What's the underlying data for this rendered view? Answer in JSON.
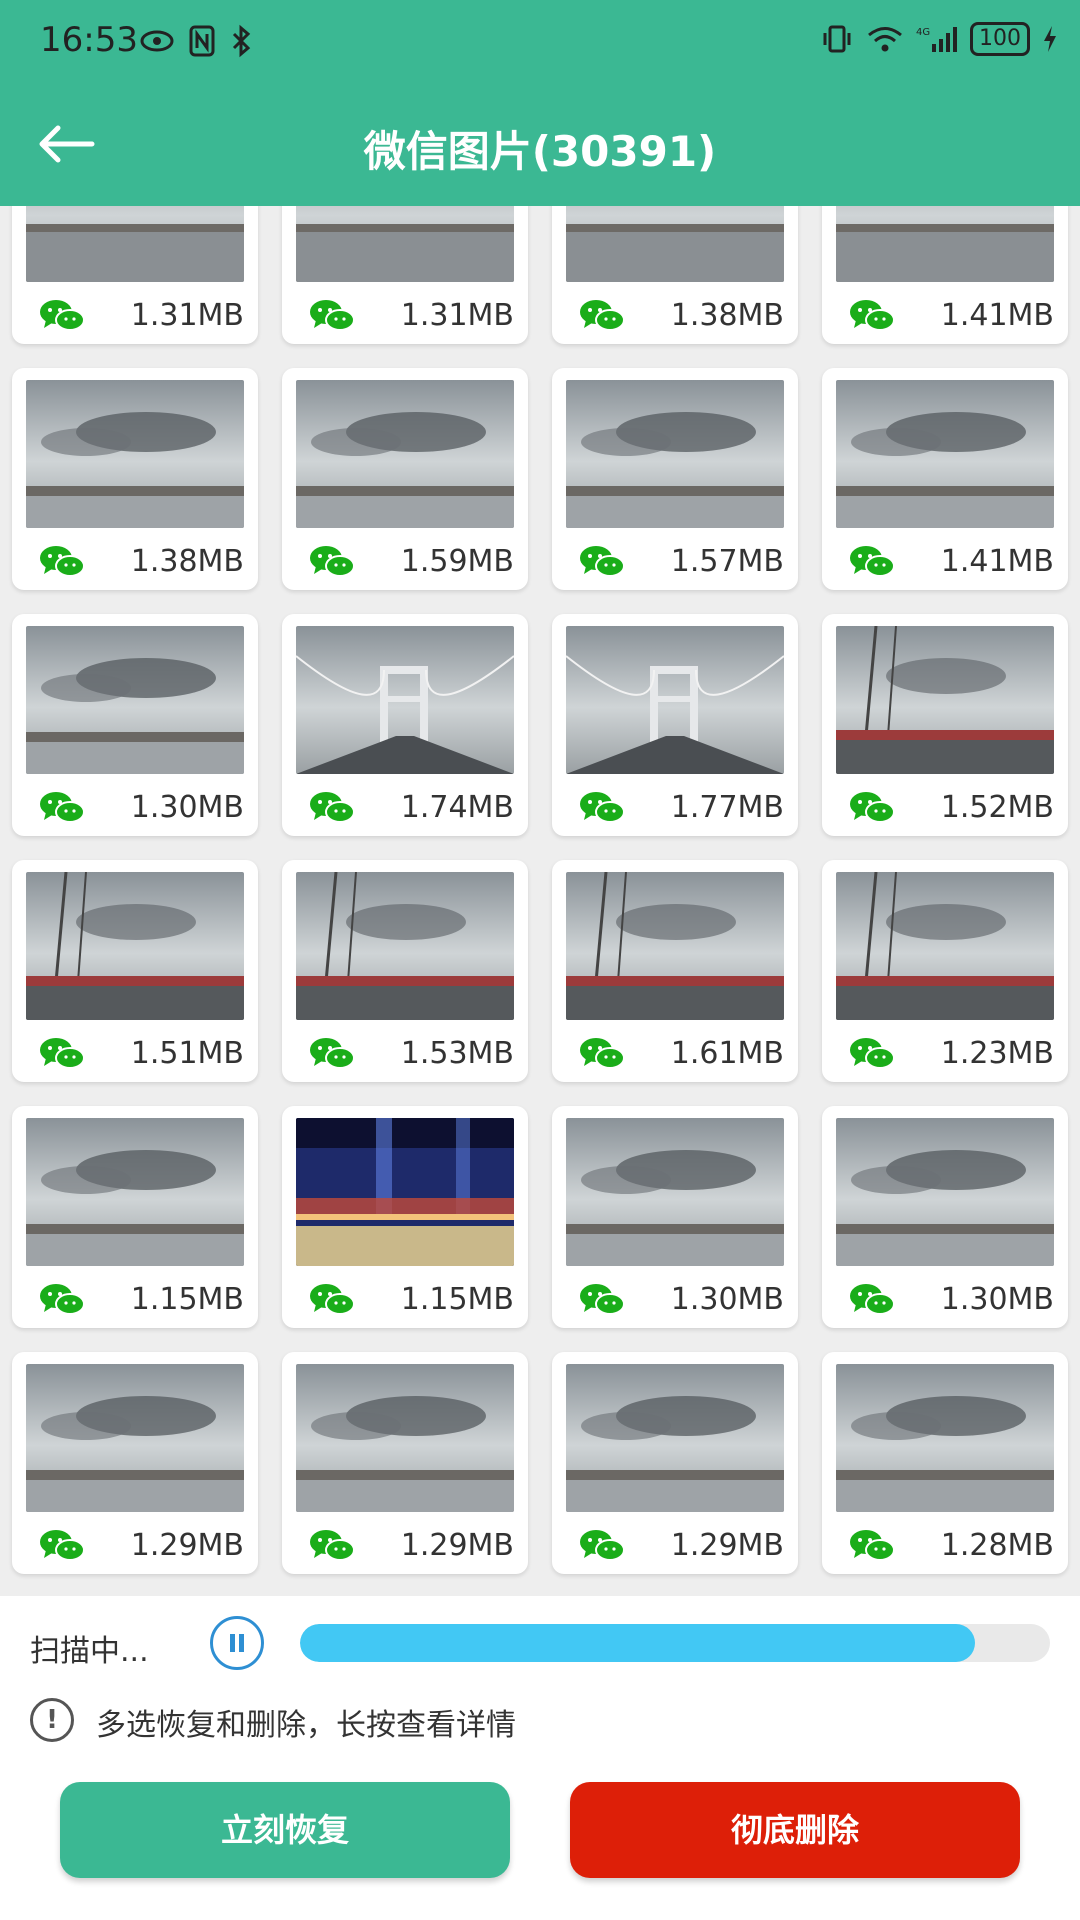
{
  "status": {
    "time": "16:53",
    "battery": "100"
  },
  "header": {
    "title": "微信图片(30391)"
  },
  "colors": {
    "accent": "#3bb893",
    "danger": "#dd1f08",
    "progress": "#42c8f4",
    "wechat": "#1aad19"
  },
  "items": [
    {
      "size": "1.31MB",
      "scene": "bridge"
    },
    {
      "size": "1.31MB",
      "scene": "bridge"
    },
    {
      "size": "1.38MB",
      "scene": "bridge"
    },
    {
      "size": "1.41MB",
      "scene": "bridge"
    },
    {
      "size": "1.38MB",
      "scene": "clouds"
    },
    {
      "size": "1.59MB",
      "scene": "clouds"
    },
    {
      "size": "1.57MB",
      "scene": "clouds"
    },
    {
      "size": "1.41MB",
      "scene": "clouds"
    },
    {
      "size": "1.30MB",
      "scene": "clouds"
    },
    {
      "size": "1.74MB",
      "scene": "suspension"
    },
    {
      "size": "1.77MB",
      "scene": "suspension"
    },
    {
      "size": "1.52MB",
      "scene": "cables"
    },
    {
      "size": "1.51MB",
      "scene": "cables"
    },
    {
      "size": "1.53MB",
      "scene": "cables"
    },
    {
      "size": "1.61MB",
      "scene": "cables"
    },
    {
      "size": "1.23MB",
      "scene": "cables"
    },
    {
      "size": "1.15MB",
      "scene": "clouds"
    },
    {
      "size": "1.15MB",
      "scene": "night"
    },
    {
      "size": "1.30MB",
      "scene": "clouds"
    },
    {
      "size": "1.30MB",
      "scene": "clouds"
    },
    {
      "size": "1.29MB",
      "scene": "clouds"
    },
    {
      "size": "1.29MB",
      "scene": "clouds"
    },
    {
      "size": "1.29MB",
      "scene": "clouds"
    },
    {
      "size": "1.28MB",
      "scene": "clouds"
    }
  ],
  "scan": {
    "label": "扫描中...",
    "progress": 0.9
  },
  "tip": {
    "icon": "!",
    "text": "多选恢复和删除，长按查看详情"
  },
  "actions": {
    "restore": "立刻恢复",
    "delete": "彻底删除"
  }
}
